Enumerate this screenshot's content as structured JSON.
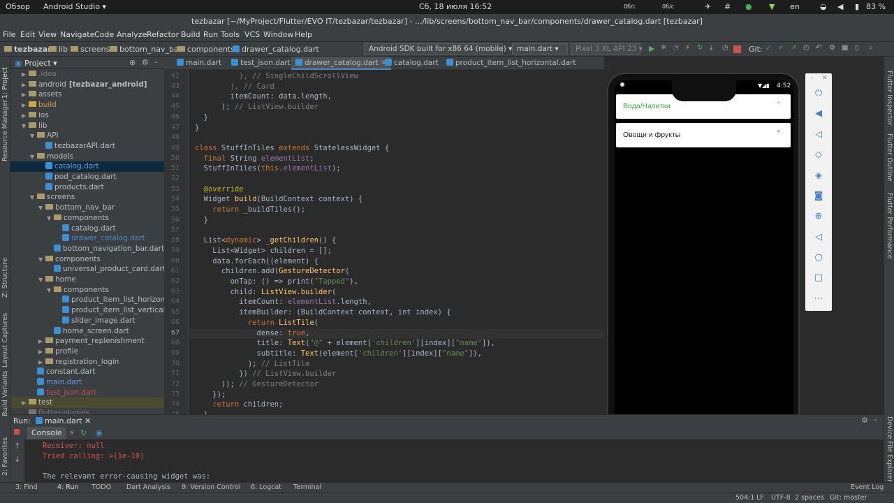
{
  "system_bar": {
    "overview": "Обзор",
    "app": "Android Studio ▾",
    "datetime": "Сб, 18 июля 16:52",
    "net_down": "0б/с",
    "net_up": "0б/с",
    "lang": "en",
    "battery": "83 %"
  },
  "window_title": "tezbazar [~/MyProject/Flutter/EVO IT/tezbazar/tezbazar] - .../lib/screens/bottom_nav_bar/components/drawer_catalog.dart [tezbazar]",
  "menu": [
    "File",
    "Edit",
    "View",
    "Navigate",
    "Code",
    "Analyze",
    "Refactor",
    "Build",
    "Run",
    "Tools",
    "VCS",
    "Window",
    "Help"
  ],
  "breadcrumbs": [
    "tezbazar",
    "lib",
    "screens",
    "bottom_nav_bar",
    "components",
    "drawer_catalog.dart"
  ],
  "toolbar": {
    "device_config": "Android SDK built for x86 64 (mobile)",
    "run_config": "main.dart",
    "avd": "Pixel 3 XL API 23",
    "git_label": "Git:"
  },
  "left_strip": [
    "1: Project",
    "Resource Manager",
    "Z: Structure",
    "Layout Captures",
    "Build Variants",
    "2: Favorites"
  ],
  "right_strip": [
    "Flutter Inspector",
    "Flutter Outline",
    "Flutter Performance",
    "Device File Explorer"
  ],
  "project_panel": {
    "title": "Project ▾"
  },
  "tree": [
    {
      "label": ".idea",
      "depth": 1,
      "kind": "folder",
      "arrow": "▶",
      "style": "dim"
    },
    {
      "label": "android",
      "extra": "[tezbazar_android]",
      "depth": 1,
      "kind": "folder",
      "arrow": "▶"
    },
    {
      "label": "assets",
      "depth": 1,
      "kind": "folder",
      "arrow": "▶"
    },
    {
      "label": "build",
      "depth": 1,
      "kind": "folder",
      "arrow": "▶",
      "style": "build"
    },
    {
      "label": "ios",
      "depth": 1,
      "kind": "folder",
      "arrow": "▶"
    },
    {
      "label": "lib",
      "depth": 1,
      "kind": "folder",
      "arrow": "▼"
    },
    {
      "label": "API",
      "depth": 2,
      "kind": "folder",
      "arrow": "▼"
    },
    {
      "label": "tezbazarAPI.dart",
      "depth": 3,
      "kind": "dart"
    },
    {
      "label": "models",
      "depth": 2,
      "kind": "folder",
      "arrow": "▼"
    },
    {
      "label": "catalog.dart",
      "depth": 3,
      "kind": "dart",
      "style": "sel"
    },
    {
      "label": "pod_catalog.dart",
      "depth": 3,
      "kind": "dart"
    },
    {
      "label": "products.dart",
      "depth": 3,
      "kind": "dart"
    },
    {
      "label": "screens",
      "depth": 2,
      "kind": "folder",
      "arrow": "▼"
    },
    {
      "label": "bottom_nav_bar",
      "depth": 3,
      "kind": "folder",
      "arrow": "▼"
    },
    {
      "label": "components",
      "depth": 4,
      "kind": "folder",
      "arrow": "▼"
    },
    {
      "label": "catalog.dart",
      "depth": 5,
      "kind": "dart"
    },
    {
      "label": "drawer_catalog.dart",
      "depth": 5,
      "kind": "dart",
      "style": "active"
    },
    {
      "label": "bottom_navigation_bar.dart",
      "depth": 4,
      "kind": "dart"
    },
    {
      "label": "components",
      "depth": 3,
      "kind": "folder",
      "arrow": "▼"
    },
    {
      "label": "universal_product_card.dart",
      "depth": 4,
      "kind": "dart"
    },
    {
      "label": "home",
      "depth": 3,
      "kind": "folder",
      "arrow": "▼"
    },
    {
      "label": "components",
      "depth": 4,
      "kind": "folder",
      "arrow": "▼"
    },
    {
      "label": "product_item_list_horizontal",
      "depth": 5,
      "kind": "dart"
    },
    {
      "label": "product_item_list_vertical.da",
      "depth": 5,
      "kind": "dart"
    },
    {
      "label": "slider_image.dart",
      "depth": 5,
      "kind": "dart"
    },
    {
      "label": "home_screen.dart",
      "depth": 4,
      "kind": "dart"
    },
    {
      "label": "payment_replenishment",
      "depth": 3,
      "kind": "folder",
      "arrow": "▶"
    },
    {
      "label": "profile",
      "depth": 3,
      "kind": "folder",
      "arrow": "▶"
    },
    {
      "label": "registration_login",
      "depth": 3,
      "kind": "folder",
      "arrow": "▶"
    },
    {
      "label": "constant.dart",
      "depth": 2,
      "kind": "dart"
    },
    {
      "label": "main.dart",
      "depth": 2,
      "kind": "dart",
      "style": "mod"
    },
    {
      "label": "test_json.dart",
      "depth": 2,
      "kind": "dart",
      "style": "red"
    },
    {
      "label": "test",
      "depth": 1,
      "kind": "folder",
      "arrow": "▶",
      "style": "hl"
    },
    {
      "label": "flutter-plugins",
      "depth": 1,
      "kind": "file",
      "style": "dim"
    }
  ],
  "editor_tabs": [
    {
      "label": "main.dart"
    },
    {
      "label": "test_json.dart"
    },
    {
      "label": "drawer_catalog.dart",
      "active": true
    },
    {
      "label": "catalog.dart"
    },
    {
      "label": "product_item_list_horizontal.dart"
    }
  ],
  "code": [
    {
      "n": "42",
      "h": "          <span class=\"c\">), // SingleChildScrollView</span>"
    },
    {
      "n": "43",
      "h": "        <span class=\"c\">), // Card</span>"
    },
    {
      "n": "44",
      "h": "        itemCount: data.length,"
    },
    {
      "n": "45",
      "h": "      ); <span class=\"c\">// ListView.builder</span>"
    },
    {
      "n": "46",
      "h": "  }"
    },
    {
      "n": "47",
      "h": "}"
    },
    {
      "n": "48",
      "h": ""
    },
    {
      "n": "49",
      "h": "<span class=\"k\">class</span> StuffInTiles <span class=\"k\">extends</span> StatelessWidget {"
    },
    {
      "n": "50",
      "h": "  <span class=\"k\">final</span> String <span class=\"p\">elementList</span>;"
    },
    {
      "n": "51",
      "h": "  StuffInTiles(<span class=\"k\">this</span>.<span class=\"p\">elementList</span>);"
    },
    {
      "n": "52",
      "h": ""
    },
    {
      "n": "53",
      "h": "  <span class=\"a\">@override</span>"
    },
    {
      "n": "54",
      "h": "  Widget <span class=\"f\">build</span>(BuildContext context) {"
    },
    {
      "n": "55",
      "h": "    <span class=\"k\">return</span> _buildTiles();"
    },
    {
      "n": "56",
      "h": "  }"
    },
    {
      "n": "57",
      "h": ""
    },
    {
      "n": "58",
      "h": "  List&lt;<span class=\"k\">dynamic</span>&gt; <span class=\"f\">_getChildren</span>() {"
    },
    {
      "n": "59",
      "h": "    List&lt;Widget&gt; children = [];"
    },
    {
      "n": "60",
      "h": "    data.forEach((element) {"
    },
    {
      "n": "61",
      "h": "      children.add(<span class=\"f\">GestureDetector</span>("
    },
    {
      "n": "62",
      "h": "        onTap: () =&gt; print(<span class=\"s\">\"Tapped\"</span>),"
    },
    {
      "n": "63",
      "h": "        child: <span class=\"f\">ListView.builder</span>("
    },
    {
      "n": "64",
      "h": "          itemCount: <span class=\"p\">elementList</span>.length,"
    },
    {
      "n": "65",
      "h": "          itemBuilder: (BuildContext context, int index) {"
    },
    {
      "n": "66",
      "h": "            <span class=\"k\">return</span> <span class=\"f\">ListTile</span>("
    },
    {
      "n": "67",
      "h": "              dense: <span class=\"k\">true</span>,",
      "cur": true
    },
    {
      "n": "68",
      "h": "              title: <span class=\"f\">Text</span>(<span class=\"s\">\"@\"</span> + element[<span class=\"s\">'children'</span>][index][<span class=\"s\">\"name\"</span>]),"
    },
    {
      "n": "69",
      "h": "              subtitle: <span class=\"f\">Text</span>(element[<span class=\"s\">'children'</span>][index][<span class=\"s\">\"name\"</span>]),"
    },
    {
      "n": "70",
      "h": "            ); <span class=\"c\">// ListTile</span>"
    },
    {
      "n": "71",
      "h": "          }) <span class=\"c\">// ListView.builder</span>"
    },
    {
      "n": "72",
      "h": "      )); <span class=\"c\">// GestureDetector</span>"
    },
    {
      "n": "73",
      "h": "    });"
    },
    {
      "n": "74",
      "h": "    <span class=\"k\">return</span> children;"
    },
    {
      "n": "75",
      "h": "  }"
    }
  ],
  "run_panel": {
    "label": "Run:",
    "config": "main.dart",
    "console_tab": "Console",
    "lines": [
      {
        "text": "Receiver: null",
        "cls": "err"
      },
      {
        "text": "Tried calling: >(1e-10)",
        "cls": "err"
      },
      {
        "text": "",
        "cls": ""
      },
      {
        "text": "The relevant error-causing widget was:",
        "cls": "norm"
      }
    ]
  },
  "bottom_tools": [
    "3: Find",
    "4: Run",
    "TODO",
    "Dart Analysis",
    "9: Version Control",
    "6: Logcat",
    "Terminal"
  ],
  "event_log": "Event Log",
  "status": {
    "position": "504:1",
    "line_sep": "LF",
    "encoding": "UTF-8",
    "indent": "2 spaces",
    "git": "Git: master"
  },
  "phone": {
    "time": "4:52",
    "items": [
      {
        "label": "Вода/Напитки",
        "expanded": true
      },
      {
        "label": "Овощи и фрукты",
        "expanded": false
      }
    ]
  }
}
